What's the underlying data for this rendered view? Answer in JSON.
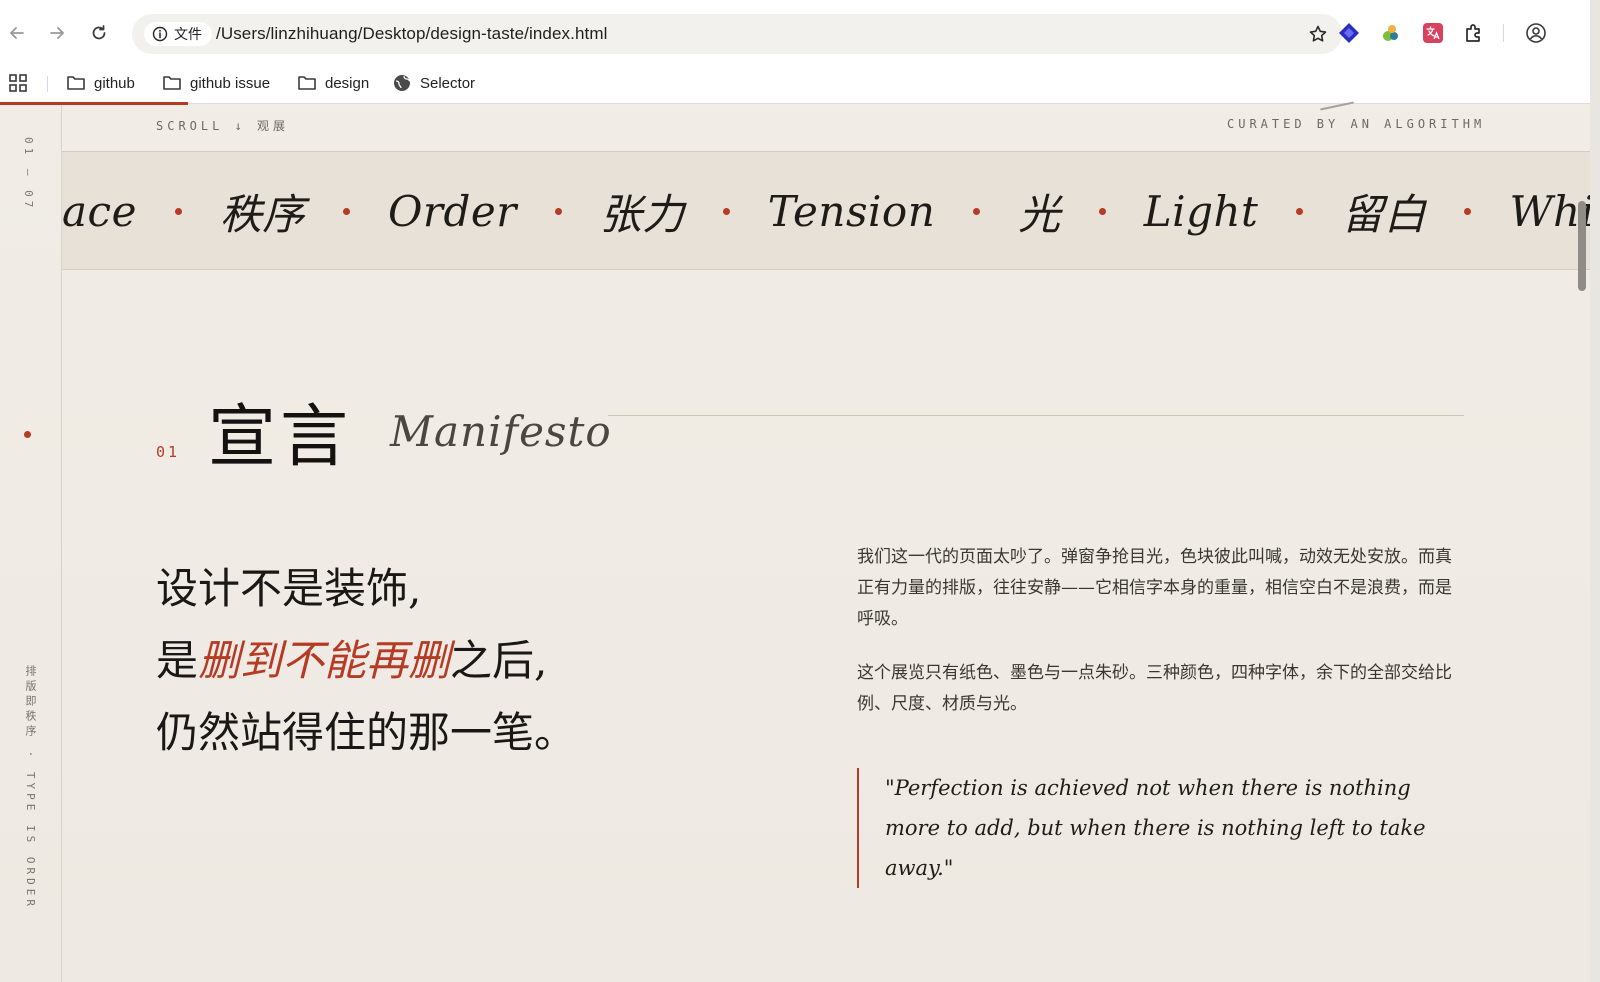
{
  "browser": {
    "site_info_label": "文件",
    "url": "/Users/linzhihuang/Desktop/design-taste/index.html",
    "bookmarks": [
      {
        "label": "github",
        "icon": "folder-icon"
      },
      {
        "label": "github issue",
        "icon": "folder-icon"
      },
      {
        "label": "design",
        "icon": "folder-icon"
      },
      {
        "label": "Selector",
        "icon": "globe-icon"
      }
    ],
    "accent_color": "#b63b25"
  },
  "page": {
    "rail_counter": "01 — 07",
    "rail_caption": "排版即秩序 · TYPE IS ORDER",
    "scroll_hint": "SCROLL ↓ 观展",
    "curated": "CURATED BY AN ALGORITHM",
    "marquee": [
      "ace",
      "秩序",
      "Order",
      "张力",
      "Tension",
      "光",
      "Light",
      "留白",
      "Whitespace"
    ],
    "section": {
      "number": "01",
      "title": "宣言",
      "subtitle": "Manifesto"
    },
    "headline": {
      "line1": "设计不是装饰,",
      "line2_prefix": "是",
      "line2_highlight": "删到不能再删",
      "line2_suffix": "之后,",
      "line3": "仍然站得住的那一笔。"
    },
    "paragraph1": "我们这一代的页面太吵了。弹窗争抢目光，色块彼此叫喊，动效无处安放。而真正有力量的排版，往往安静——它相信字本身的重量，相信空白不是浪费，而是呼吸。",
    "paragraph2": "这个展览只有纸色、墨色与一点朱砂。三种颜色，四种字体，余下的全部交给比例、尺度、材质与光。",
    "quote": "\"Perfection is achieved not when there is nothing more to add, but when there is nothing left to take away.\""
  }
}
